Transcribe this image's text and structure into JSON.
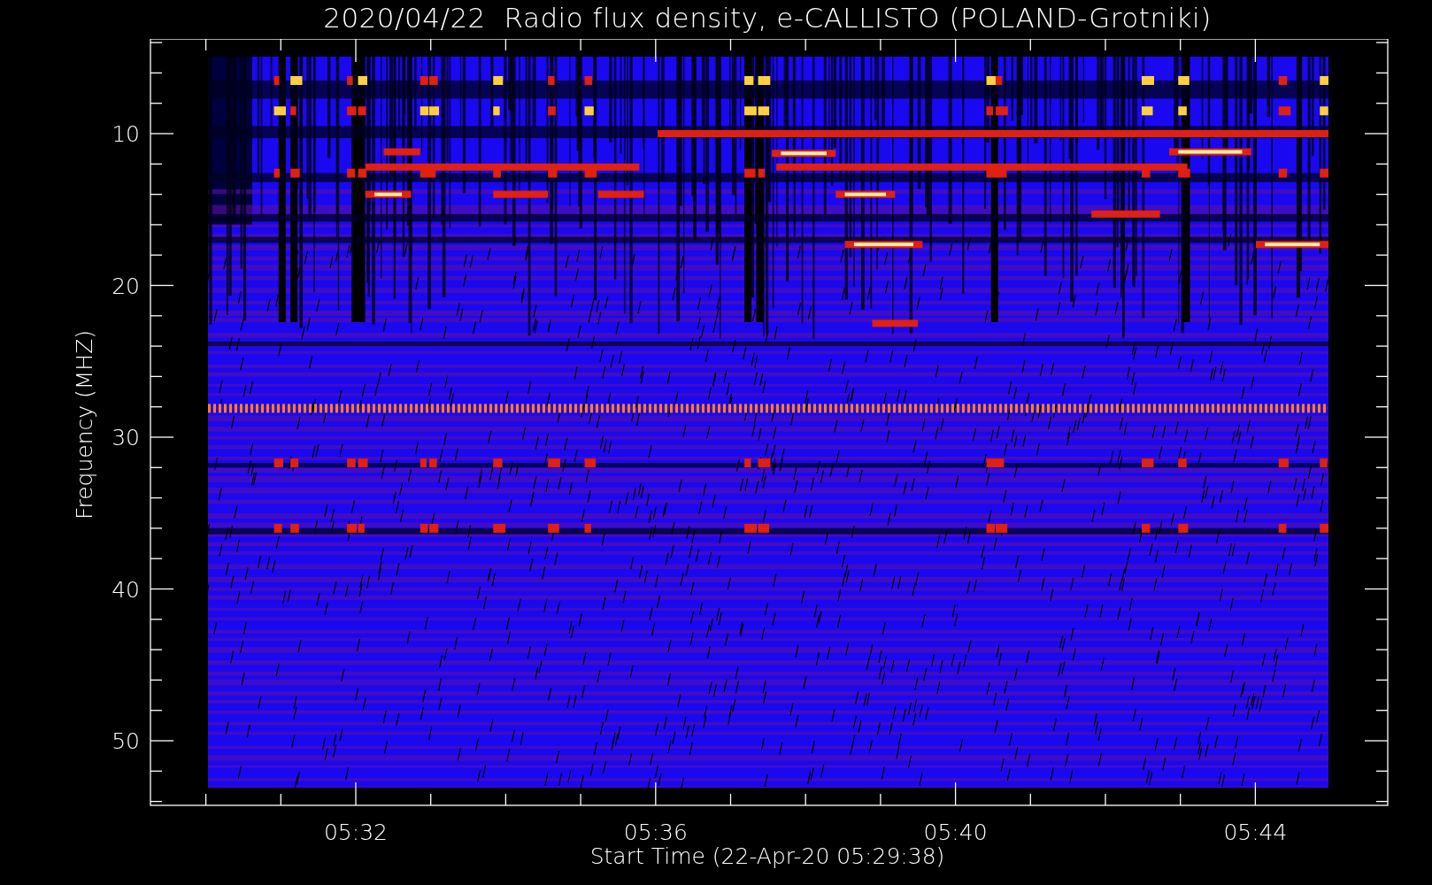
{
  "title": "2020/04/22  Radio flux density, e-CALLISTO (POLAND-Grotniki)",
  "y_axis": {
    "label": "Frequency (MHZ)",
    "ticks": [
      "10",
      "20",
      "30",
      "40",
      "50"
    ]
  },
  "x_axis": {
    "label": "Start Time (22-Apr-20 05:29:38)",
    "ticks": [
      "05:32",
      "05:36",
      "05:40",
      "05:44"
    ]
  }
}
